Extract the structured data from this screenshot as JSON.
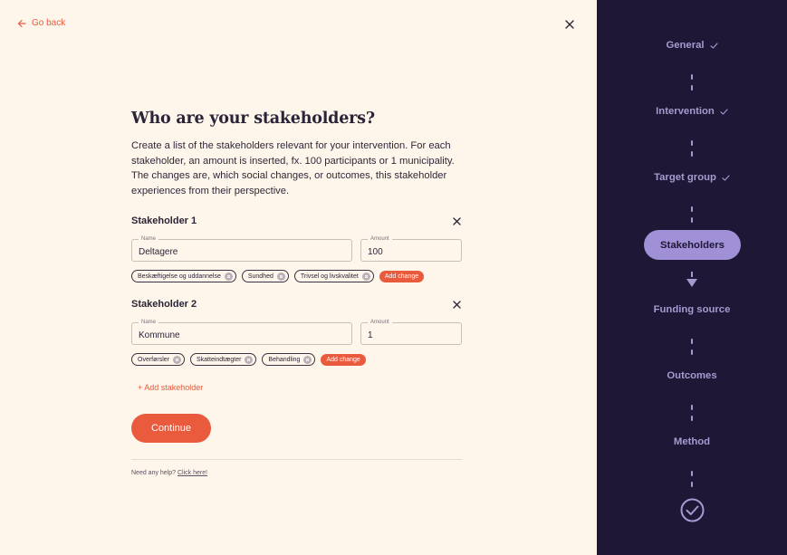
{
  "nav": {
    "go_back": "Go back"
  },
  "page": {
    "title": "Who are your stakeholders?",
    "description": "Create a list of the stakeholders relevant for your intervention. For each stakeholder, an amount is inserted, fx. 100 participants or 1 municipality. The changes are, which social changes, or outcomes, this stakeholder experiences from their perspective."
  },
  "stakeholders": [
    {
      "title": "Stakeholder 1",
      "name_label": "Name",
      "name_value": "Deltagere",
      "amount_label": "Amount",
      "amount_value": "100",
      "changes": [
        "Beskæftigelse og uddannelse",
        "Sundhed",
        "Trivsel og livskvalitet"
      ],
      "add_change": "Add change"
    },
    {
      "title": "Stakeholder 2",
      "name_label": "Name",
      "name_value": "Kommune",
      "amount_label": "Amount",
      "amount_value": "1",
      "changes": [
        "Overførsler",
        "Skatteindtægter",
        "Behandling"
      ],
      "add_change": "Add change"
    }
  ],
  "actions": {
    "add_stakeholder": "+ Add stakeholder",
    "continue": "Continue"
  },
  "help": {
    "text": "Need any help?",
    "link": "Click here!"
  },
  "steps": [
    {
      "label": "General",
      "status": "done"
    },
    {
      "label": "Intervention",
      "status": "done"
    },
    {
      "label": "Target group",
      "status": "done"
    },
    {
      "label": "Stakeholders",
      "status": "active"
    },
    {
      "label": "Funding source",
      "status": "pending"
    },
    {
      "label": "Outcomes",
      "status": "pending"
    },
    {
      "label": "Method",
      "status": "pending"
    }
  ],
  "colors": {
    "accent": "#ea5a3d",
    "sidebar_bg": "#1f1736",
    "sidebar_text": "#a79ad0",
    "active_step_bg": "#a090d6",
    "page_bg": "#fef6ea"
  }
}
